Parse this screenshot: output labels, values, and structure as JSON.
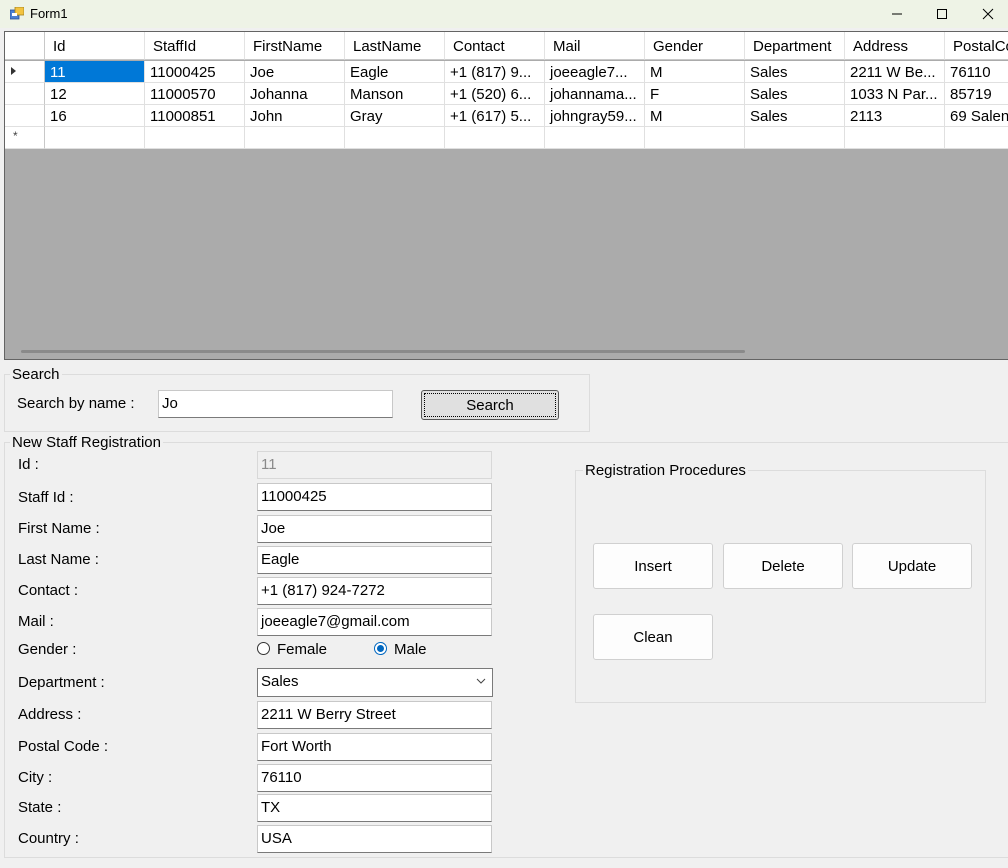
{
  "window": {
    "title": "Form1"
  },
  "grid": {
    "columns": [
      "Id",
      "StaffId",
      "FirstName",
      "LastName",
      "Contact",
      "Mail",
      "Gender",
      "Department",
      "Address",
      "PostalCo"
    ],
    "rows": [
      [
        "11",
        "11000425",
        "Joe",
        "Eagle",
        "+1 (817) 9...",
        "joeeagle7...",
        "M",
        "Sales",
        "2211 W Be...",
        "76110"
      ],
      [
        "12",
        "11000570",
        "Johanna",
        "Manson",
        "+1 (520) 6...",
        "johannama...",
        "F",
        "Sales",
        "1033 N Par...",
        "85719"
      ],
      [
        "16",
        "11000851",
        "John",
        "Gray",
        "+1 (617) 5...",
        "johngray59...",
        "M",
        "Sales",
        "2113",
        "69 Salen"
      ]
    ],
    "new_row_marker": "*"
  },
  "search": {
    "group_title": "Search",
    "label": "Search by name :",
    "value": "Jo",
    "button_label": "Search"
  },
  "registration": {
    "group_title": "New Staff Registration",
    "id_label": "Id :",
    "id_value": "11",
    "staffid_label": "Staff Id :",
    "staffid_value": "11000425",
    "firstname_label": "First Name :",
    "firstname_value": "Joe",
    "lastname_label": "Last Name :",
    "lastname_value": "Eagle",
    "contact_label": "Contact :",
    "contact_value": "+1 (817) 924-7272",
    "mail_label": "Mail :",
    "mail_value": "joeeagle7@gmail.com",
    "gender_label": "Gender :",
    "female_label": "Female",
    "male_label": "Male",
    "gender_selected": "Male",
    "department_label": "Department :",
    "department_value": "Sales",
    "address_label": "Address :",
    "address_value": "2211 W Berry Street",
    "postal_label": "Postal Code :",
    "postal_value": "Fort Worth",
    "city_label": "City :",
    "city_value": "76110",
    "state_label": "State :",
    "state_value": "TX",
    "country_label": "Country :",
    "country_value": "USA"
  },
  "procedures": {
    "group_title": "Registration Procedures",
    "insert_label": "Insert",
    "delete_label": "Delete",
    "update_label": "Update",
    "clean_label": "Clean"
  },
  "colors": {
    "selection": "#0078d7",
    "radio_accent": "#0067c0",
    "grid_background": "#ababab"
  }
}
